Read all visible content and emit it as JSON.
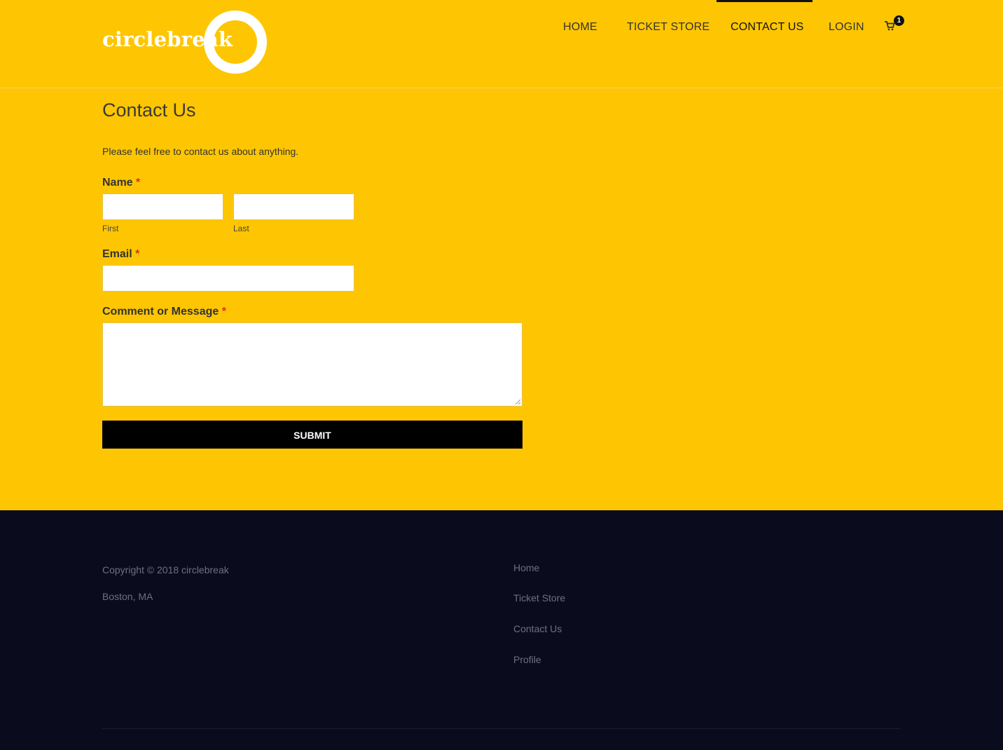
{
  "brand": {
    "logo_text": "circlebreak",
    "logo_color": "#ffffff"
  },
  "theme": {
    "primary": "#fec602",
    "footer_bg": "#0a0c1e",
    "accent_required": "#e0301e"
  },
  "nav": {
    "items": [
      {
        "label": "HOME",
        "active": false
      },
      {
        "label": "TICKET STORE",
        "active": false
      },
      {
        "label": "CONTACT US",
        "active": true
      },
      {
        "label": "LOGIN",
        "active": false
      }
    ],
    "cart": {
      "icon": "cart-icon",
      "count": "1"
    }
  },
  "main": {
    "title": "Contact Us",
    "intro": "Please feel free to contact us about anything.",
    "form": {
      "name_label": "Name",
      "required_mark": "*",
      "first_sublabel": "First",
      "last_sublabel": "Last",
      "email_label": "Email",
      "message_label": "Comment or Message",
      "first_value": "",
      "last_value": "",
      "email_value": "",
      "message_value": "",
      "submit_label": "SUBMIT"
    }
  },
  "footer": {
    "copyright": "Copyright © 2018 circlebreak",
    "location": "Boston, MA",
    "links": [
      "Home",
      "Ticket Store",
      "Contact Us",
      "Profile"
    ]
  }
}
